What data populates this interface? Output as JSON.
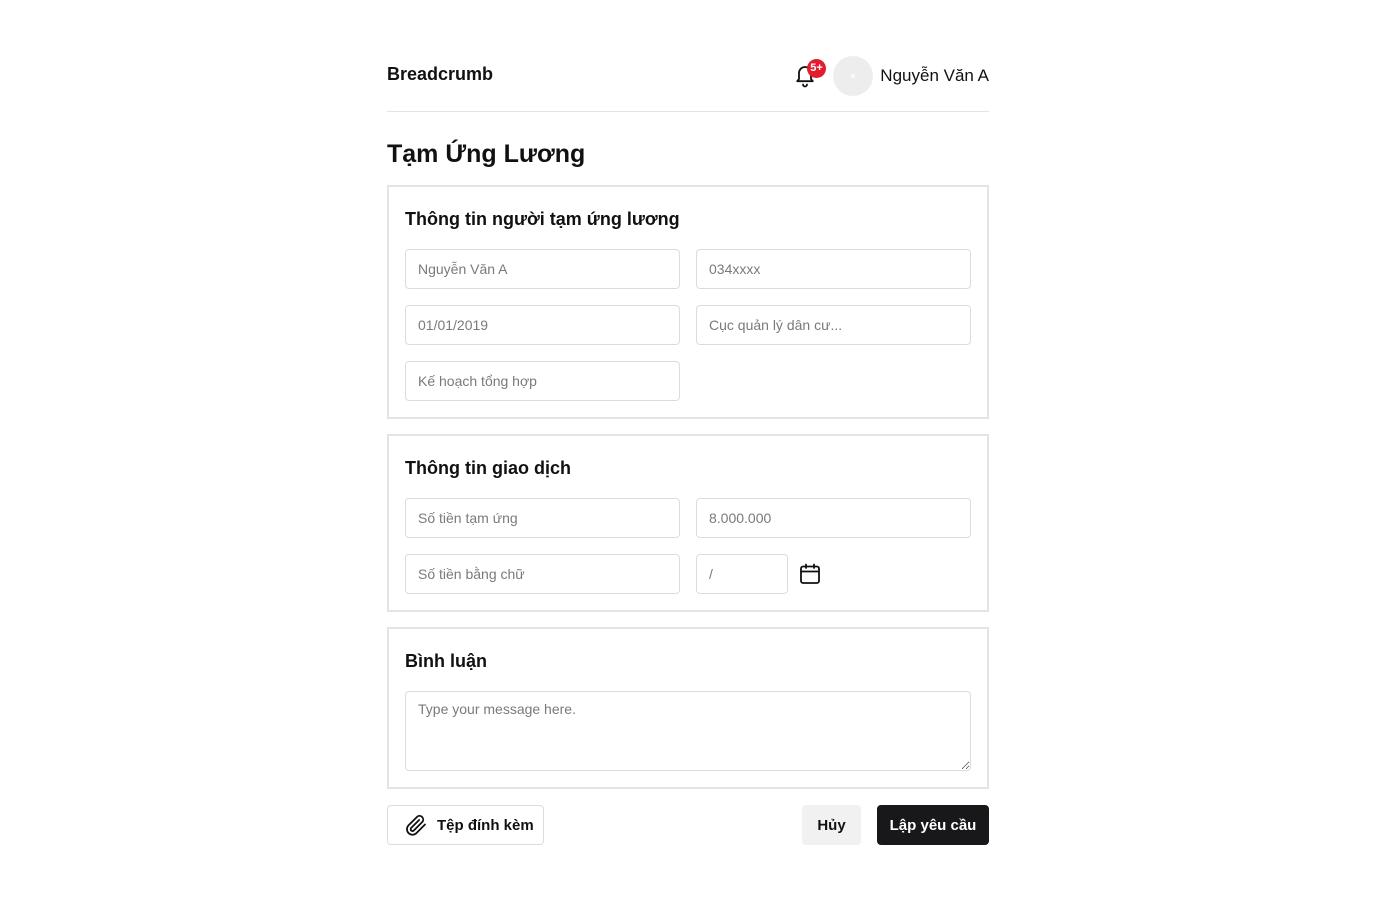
{
  "header": {
    "breadcrumb": "Breadcrumb",
    "notification_badge": "5+",
    "user_name": "Nguyễn Văn A"
  },
  "page": {
    "title": "Tạm Ứng Lương"
  },
  "applicant": {
    "title": "Thông tin người tạm ứng lương",
    "name_placeholder": "Nguyễn Văn A",
    "phone_placeholder": "034xxxx",
    "date_placeholder": "01/01/2019",
    "department_placeholder": "Cục quản lý dân cư...",
    "position_placeholder": "Kế hoạch tổng hợp"
  },
  "transaction": {
    "title": "Thông tin giao dịch",
    "amount_placeholder": "Số tiền tạm ứng",
    "amount_value_placeholder": "8.000.000",
    "amount_words_placeholder": "Số tiền bằng chữ",
    "date_placeholder": "/"
  },
  "comment": {
    "title": "Bình luận",
    "placeholder": "Type your message here."
  },
  "footer": {
    "attach_label": "Tệp đính kèm",
    "cancel_label": "Hủy",
    "submit_label": "Lập yêu cầu"
  },
  "colors": {
    "badge": "#e11d2e",
    "primary_button": "#18181b",
    "secondary_button": "#f1f1f2",
    "border": "#e4e4e7"
  },
  "icons": [
    "bell-icon",
    "calendar-icon",
    "paperclip-icon"
  ]
}
